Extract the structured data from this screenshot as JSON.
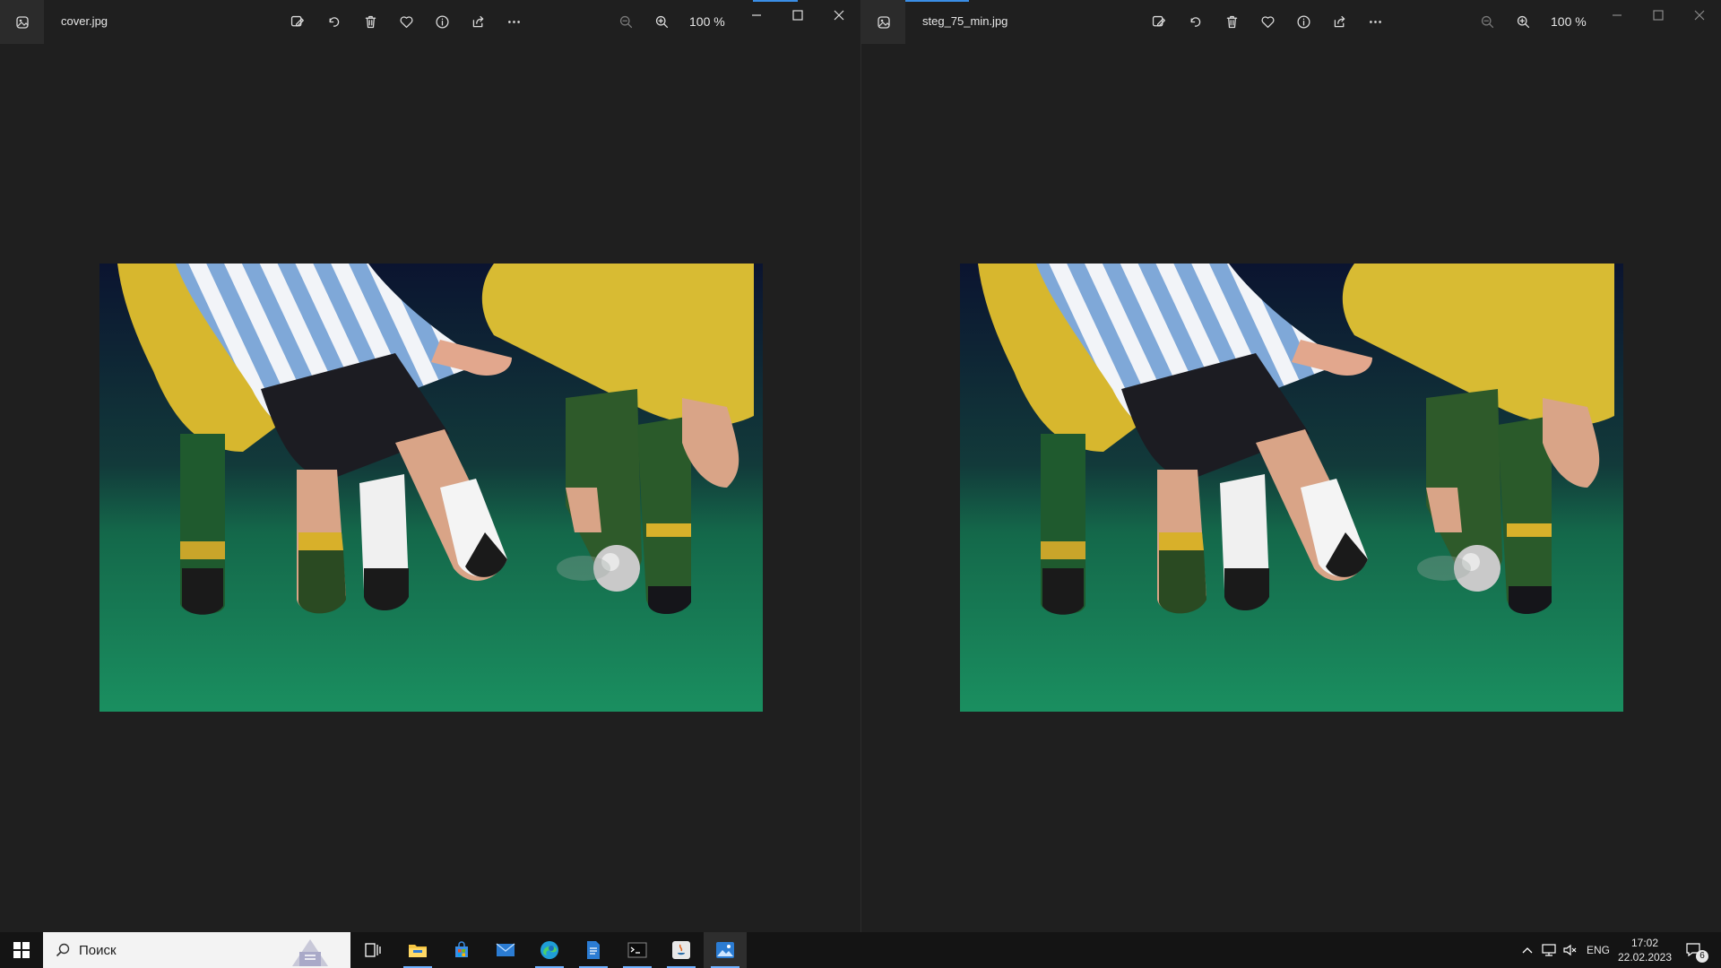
{
  "left_window": {
    "filename": "cover.jpg",
    "zoom": "100 %",
    "toolbar": [
      "edit-icon",
      "rotate-icon",
      "delete-icon",
      "favorite-icon",
      "info-icon",
      "share-icon",
      "more-icon",
      "zoom-out-icon",
      "zoom-in-icon"
    ]
  },
  "right_window": {
    "filename": "steg_75_min.jpg",
    "zoom": "100 %",
    "toolbar": [
      "edit-icon",
      "rotate-icon",
      "delete-icon",
      "favorite-icon",
      "info-icon",
      "share-icon",
      "more-icon",
      "zoom-out-icon",
      "zoom-in-icon"
    ]
  },
  "taskbar": {
    "search_placeholder": "Поиск",
    "apps": [
      "task-view-icon",
      "file-explorer-icon",
      "store-icon",
      "mail-icon",
      "edge-icon",
      "notepad-icon",
      "terminal-icon",
      "java-icon",
      "photos-icon"
    ],
    "language": "ENG",
    "time": "17:02",
    "date": "22.02.2023",
    "notifications": "6"
  },
  "colors": {
    "window_bg": "#1f1f1f",
    "accent": "#6fb1ff",
    "taskbar_bg": "#141414"
  }
}
